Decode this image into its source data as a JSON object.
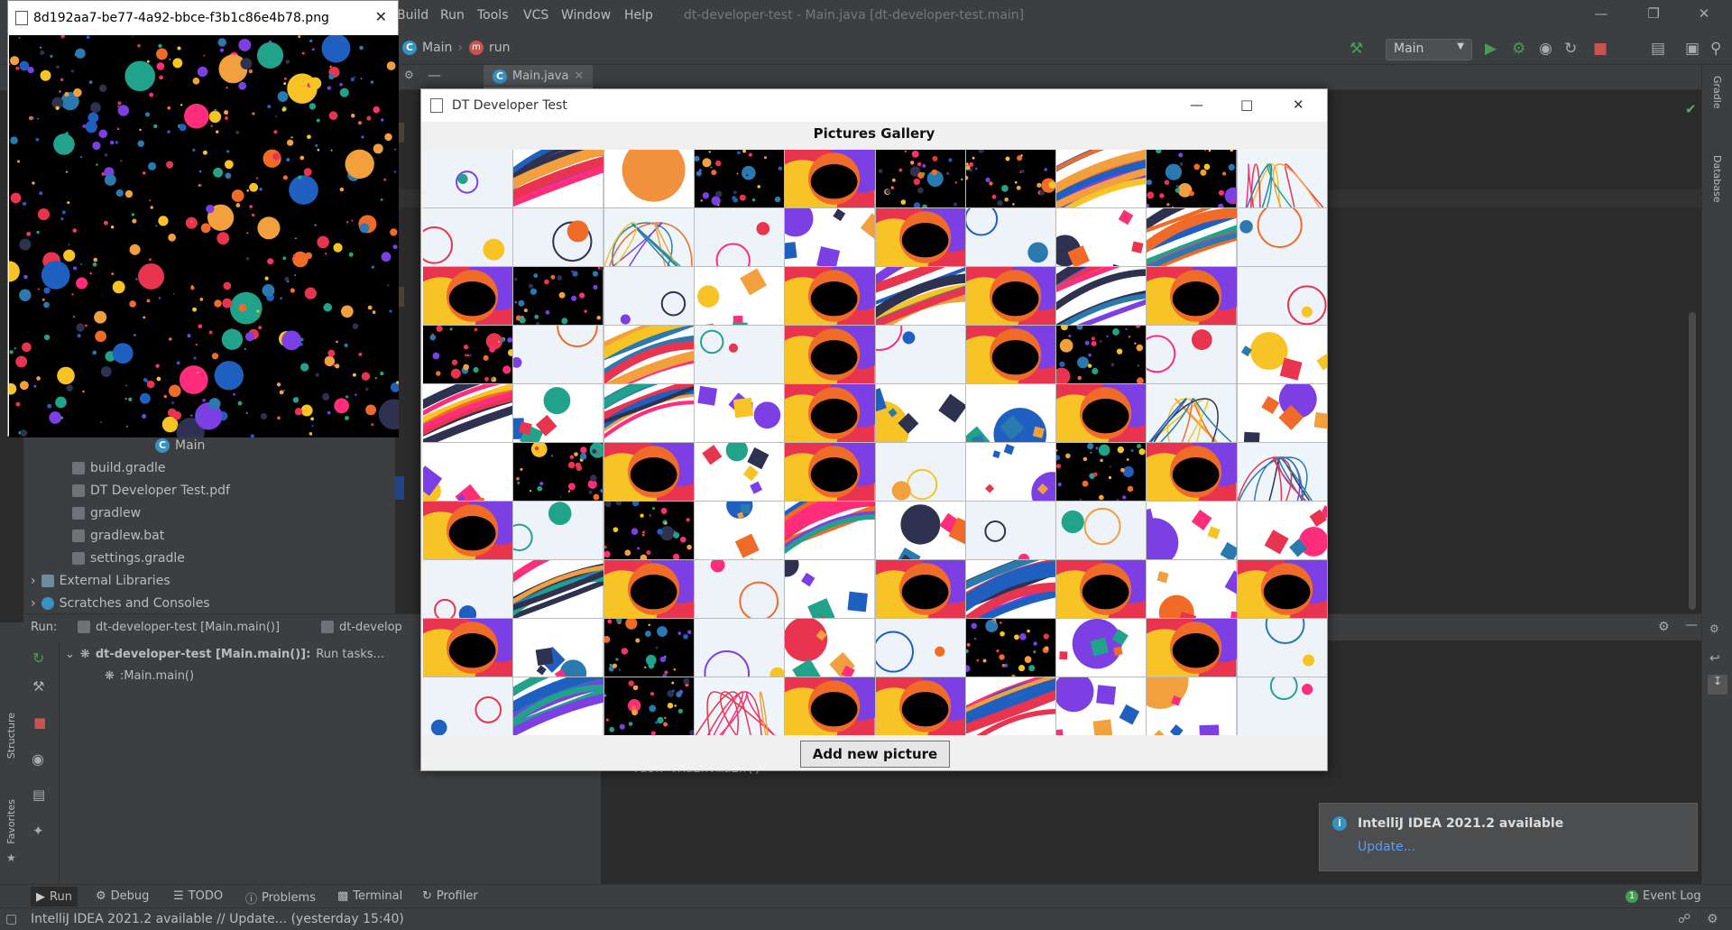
{
  "menu": {
    "items": [
      "Build",
      "Run",
      "Tools",
      "VCS",
      "Window",
      "Help"
    ],
    "title": "dt-developer-test - Main.java [dt-developer-test.main]"
  },
  "nav": {
    "crumbs": [
      "Main",
      "run"
    ],
    "run_config": "Main"
  },
  "editor": {
    "tab": "Main.java"
  },
  "right_strip": {
    "gradle": "Gradle",
    "database": "Database"
  },
  "left_strip": {
    "structure": "Structure",
    "favorites": "Favorites"
  },
  "project_tree": {
    "items": [
      "Main",
      "build.gradle",
      "DT Developer Test.pdf",
      "gradlew",
      "gradlew.bat",
      "settings.gradle",
      "External Libraries",
      "Scratches and Consoles"
    ]
  },
  "run_panel": {
    "label": "Run:",
    "tabs": [
      "dt-developer-test [Main.main()]",
      "dt-develop"
    ],
    "task_title": "dt-developer-test [Main.main()]:",
    "task_status": "Run tasks...",
    "task_child": ":Main.main()",
    "console_line": "> Task :Main.main()"
  },
  "bottom_tools": [
    "Run",
    "Debug",
    "TODO",
    "Problems",
    "Terminal",
    "Profiler"
  ],
  "event_log": "Event Log",
  "status": "IntelliJ IDEA 2021.2 available // Update... (yesterday 15:40)",
  "notification": {
    "title": "IntelliJ IDEA 2021.2 available",
    "link": "Update..."
  },
  "image_window": {
    "title": "8d192aa7-be77-4a92-bbce-f3b1c86e4b78.png"
  },
  "gallery": {
    "window_title": "DT Developer Test",
    "header": "Pictures Gallery",
    "button": "Add new picture",
    "rows": [
      [
        "circles",
        "bands",
        "blob",
        "dots",
        "fractal",
        "dots",
        "dots",
        "bands",
        "dots",
        "lines"
      ],
      [
        "circles",
        "circles",
        "lines",
        "circles",
        "shapes",
        "fractal",
        "circles",
        "shapes",
        "bands",
        "circles"
      ],
      [
        "fractal",
        "dots",
        "circles",
        "shapes",
        "fractal",
        "bands",
        "fractal",
        "bands",
        "fractal",
        "circles"
      ],
      [
        "dots",
        "circles",
        "bands",
        "circles",
        "fractal",
        "circles",
        "fractal",
        "dots",
        "circles",
        "shapes"
      ],
      [
        "bands",
        "shapes",
        "bands",
        "shapes",
        "fractal",
        "shapes",
        "shapes",
        "fractal",
        "lines",
        "shapes"
      ],
      [
        "shapes",
        "dots",
        "fractal",
        "shapes",
        "fractal",
        "circles",
        "shapes",
        "dots",
        "fractal",
        "lines"
      ],
      [
        "fractal",
        "circles",
        "dots",
        "shapes",
        "bands",
        "shapes",
        "circles",
        "circles",
        "shapes",
        "shapes"
      ],
      [
        "circles",
        "bands",
        "fractal",
        "circles",
        "shapes",
        "fractal",
        "bands",
        "fractal",
        "shapes",
        "fractal"
      ],
      [
        "fractal",
        "shapes",
        "dots",
        "circles",
        "shapes",
        "circles",
        "dots",
        "shapes",
        "fractal",
        "circles"
      ],
      [
        "circles",
        "bands",
        "dots",
        "lines",
        "fractal",
        "fractal",
        "bands",
        "shapes",
        "shapes",
        "circles"
      ]
    ]
  },
  "colors": {
    "accent": "#3592c4",
    "run_green": "#499c54",
    "stop_red": "#c75450"
  }
}
